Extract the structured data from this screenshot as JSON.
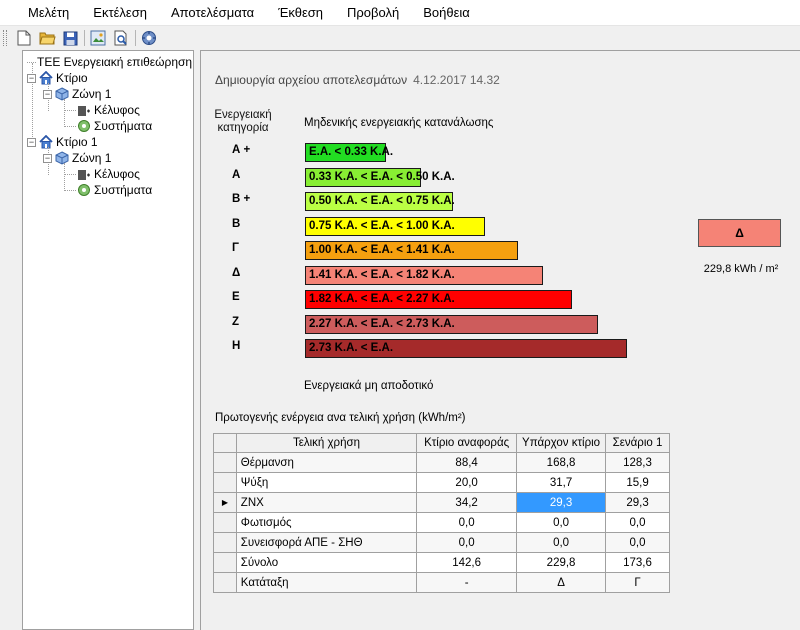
{
  "menu": [
    "Μελέτη",
    "Εκτέλεση",
    "Αποτελέσματα",
    "Έκθεση",
    "Προβολή",
    "Βοήθεια"
  ],
  "toolbar": {
    "icons": [
      "new-file-icon",
      "open-folder-icon",
      "save-icon",
      "export-icon",
      "print-preview-icon",
      "settings-icon"
    ]
  },
  "tree": {
    "root": "ΤΕΕ Ενεργειακή επιθεώρηση",
    "buildings": [
      {
        "label": "Κτίριο",
        "zone": "Ζώνη 1",
        "envelope": "Κέλυφος",
        "systems": "Συστήματα"
      },
      {
        "label": "Κτίριο 1",
        "zone": "Ζώνη 1",
        "envelope": "Κέλυφος",
        "systems": "Συστήματα"
      }
    ]
  },
  "results": {
    "created_label": "Δημιουργία αρχείου αποτελεσμάτων",
    "created_date": "4.12.2017 14.32",
    "category_header": "Ενεργειακή κατηγορία",
    "zero_label": "Μηδενικής ενεργειακής κατανάλωσης",
    "not_efficient_label": "Ενεργειακά μη αποδοτικό",
    "classes": [
      {
        "label": "Α +",
        "range": "Ε.Α. < 0.33 Κ.Α.",
        "color": "#22dd22",
        "level": 0.25
      },
      {
        "label": "Α",
        "range": "0.33 Κ.Α. < Ε.Α. < 0.50 Κ.Α.",
        "color": "#88ee33",
        "level": 0.36
      },
      {
        "label": "Β +",
        "range": "0.50 Κ.Α. < Ε.Α. < 0.75 Κ.Α.",
        "color": "#bbff44",
        "level": 0.46
      },
      {
        "label": "Β",
        "range": "0.75 Κ.Α. < Ε.Α. < 1.00 Κ.Α.",
        "color": "#ffff00",
        "level": 0.56
      },
      {
        "label": "Γ",
        "range": "1.00 Κ.Α. < Ε.Α. < 1.41 Κ.Α.",
        "color": "#f5a00f",
        "level": 0.66
      },
      {
        "label": "Δ",
        "range": "1.41 Κ.Α. < Ε.Α. < 1.82 Κ.Α.",
        "color": "#f58376",
        "level": 0.74
      },
      {
        "label": "Ε",
        "range": "1.82 Κ.Α. < Ε.Α. < 2.27 Κ.Α.",
        "color": "#ff0000",
        "level": 0.83
      },
      {
        "label": "Ζ",
        "range": "2.27 Κ.Α. < Ε.Α. < 2.73 Κ.Α.",
        "color": "#cd5c5c",
        "level": 0.91
      },
      {
        "label": "Η",
        "range": "2.73 Κ.Α. < Ε.Α.",
        "color": "#a52a2a",
        "level": 1.0
      }
    ],
    "current_class": "Δ",
    "current_value": "229,8 kWh / m²",
    "table_title": "Πρωτογενής ενέργεια ανα τελική χρήση (kWh/m²)",
    "table": {
      "columns": [
        "Τελική χρήση",
        "Κτίριο αναφοράς",
        "Υπάρχον κτίριο",
        "Σενάριο 1"
      ],
      "rows": [
        [
          "Θέρμανση",
          "88,4",
          "168,8",
          "128,3"
        ],
        [
          "Ψύξη",
          "20,0",
          "31,7",
          "15,9"
        ],
        [
          "ΖΝΧ",
          "34,2",
          "29,3",
          "29,3"
        ],
        [
          "Φωτισμός",
          "0,0",
          "0,0",
          "0,0"
        ],
        [
          "Συνεισφορά ΑΠΕ - ΣΗΘ",
          "0,0",
          "0,0",
          "0,0"
        ],
        [
          "Σύνολο",
          "142,6",
          "229,8",
          "173,6"
        ],
        [
          "Κατάταξη",
          "-",
          "Δ",
          "Γ"
        ]
      ],
      "current_row_marker": "▶"
    }
  }
}
